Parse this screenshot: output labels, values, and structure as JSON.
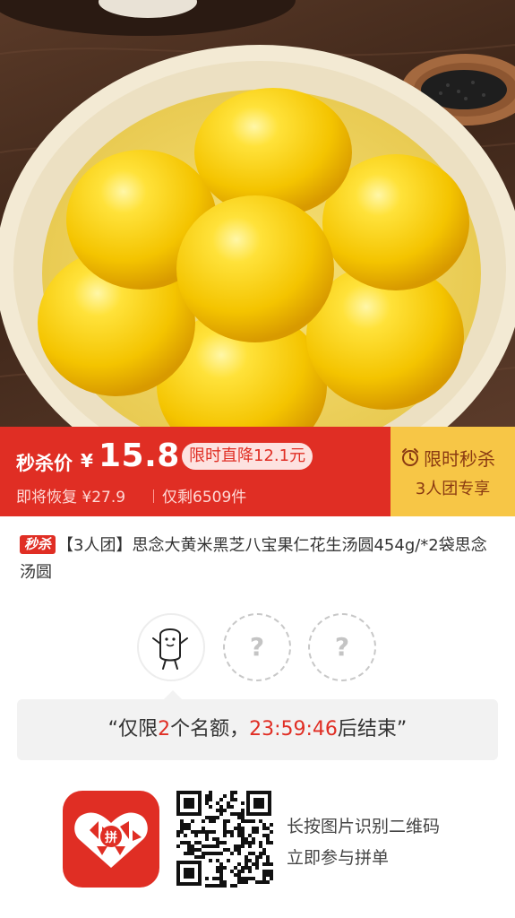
{
  "banner": {
    "seckill_label": "秒杀价",
    "currency": "¥",
    "price": "15.8",
    "discount_badge": "限时直降12.1元",
    "restore_price": "即将恢复 ¥27.9",
    "stock": "仅剩6509件",
    "timer_title": "限时秒杀",
    "group_tag": "3人团专享",
    "colors": {
      "red": "#e02e24",
      "yellow": "#f7c646"
    }
  },
  "product": {
    "seckill_tag": "秒杀",
    "title": "【3人团】思念大黄米黑芝八宝果仁花生汤圆454g/*2袋思念汤圆"
  },
  "group": {
    "empty_slot_mark": "?",
    "countdown_prefix": "“仅限",
    "spots_left": "2",
    "countdown_middle": "个名额，",
    "countdown_time": "23:59:46",
    "countdown_suffix": "后结束”"
  },
  "footer": {
    "scan_line_1": "长按图片识别二维码",
    "scan_line_2": "立即参与拼单"
  }
}
